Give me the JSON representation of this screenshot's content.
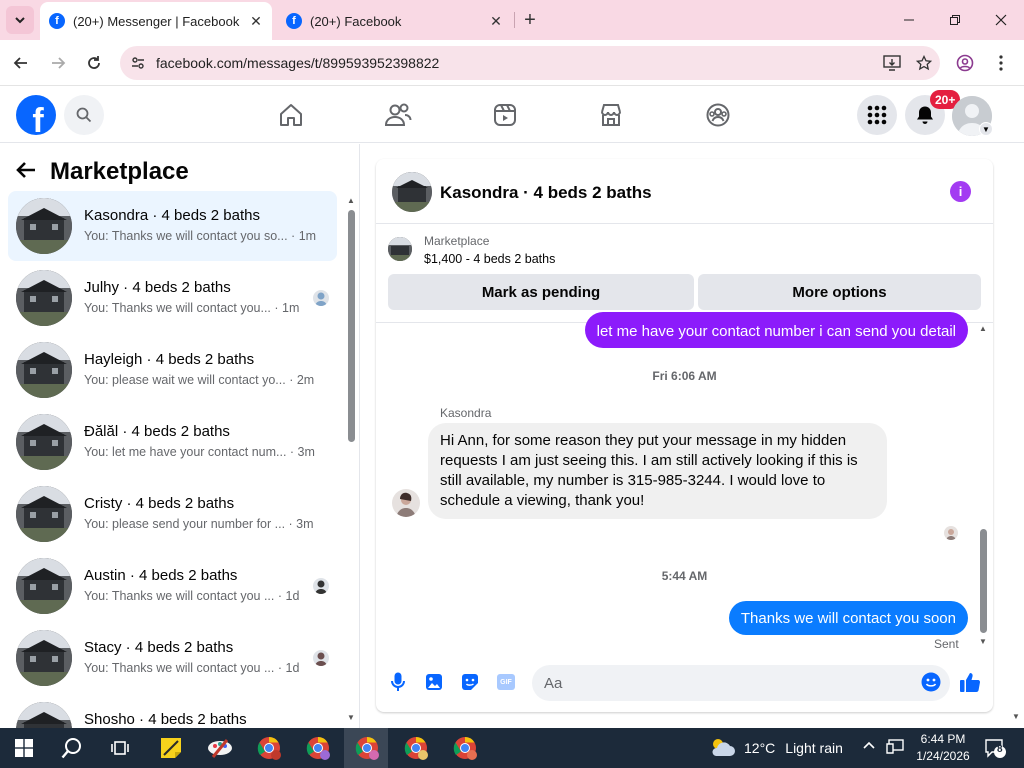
{
  "browser": {
    "tabs": [
      {
        "title": "(20+) Messenger | Facebook",
        "active": true,
        "favicon": "facebook-icon"
      },
      {
        "title": "(20+) Facebook",
        "active": false,
        "favicon": "facebook-icon"
      }
    ],
    "favicon_letter": "f",
    "url": "facebook.com/messages/t/899593952398822"
  },
  "fb": {
    "logo_letter": "f",
    "notification_count": "20+"
  },
  "left_panel": {
    "title": "Marketplace",
    "conversations": [
      {
        "title": "Kasondra · 4 beds 2 baths",
        "preview": "You: Thanks we will contact you so... · 1m",
        "active": true,
        "has_avatar": false
      },
      {
        "title": "Julhy · 4 beds 2 baths",
        "preview": "You: Thanks we will contact you... · 1m",
        "active": false,
        "has_avatar": true
      },
      {
        "title": "Hayleigh · 4 beds 2 baths",
        "preview": "You: please wait we will contact yo... · 2m",
        "active": false,
        "has_avatar": false
      },
      {
        "title": "Ðălăl · 4 beds 2 baths",
        "preview": "You: let me have your contact num... · 3m",
        "active": false,
        "has_avatar": false
      },
      {
        "title": "Cristy · 4 beds 2 baths",
        "preview": "You: please send your number for ... · 3m",
        "active": false,
        "has_avatar": false
      },
      {
        "title": "Austin · 4 beds 2 baths",
        "preview": "You: Thanks we will contact you ... · 1d",
        "active": false,
        "has_avatar": true
      },
      {
        "title": "Stacy · 4 beds 2 baths",
        "preview": "You: Thanks we will contact you ... · 1d",
        "active": false,
        "has_avatar": true
      },
      {
        "title": "Shosho · 4 beds 2 baths",
        "preview": "",
        "active": false,
        "has_avatar": false
      }
    ]
  },
  "thread": {
    "name": "Kasondra · 4 beds 2 baths",
    "info_letter": "i",
    "listing": {
      "category": "Marketplace",
      "title": "$1,400 - 4 beds 2 baths"
    },
    "buttons": {
      "mark_pending": "Mark as pending",
      "more_options": "More options"
    },
    "messages": {
      "outgoing_1": "let me have your contact number i can send you detail",
      "time_1": "Fri 6:06 AM",
      "sender": "Kasondra",
      "incoming_1": "Hi Ann, for some reason they put your message in my hidden requests I am just seeing this. I am still actively looking if this is still available, my number is 315-985-3244. I would love to schedule a viewing, thank you!",
      "time_2": "5:44 AM",
      "outgoing_2": "Thanks we will contact you soon",
      "status": "Sent"
    },
    "composer": {
      "placeholder": "Aa",
      "gif_label": "GIF"
    }
  },
  "taskbar": {
    "weather_temp": "12°C",
    "weather_desc": "Light rain",
    "time": "6:44 PM",
    "date": "1/24/2026",
    "notification_count": "8"
  },
  "colors": {
    "fb_blue": "#0866ff",
    "outgoing_purple": "#8c1bfb",
    "outgoing_blue": "#0a7cff",
    "badge_red": "#e41e3f",
    "tab_strip": "#f9d9e4"
  }
}
